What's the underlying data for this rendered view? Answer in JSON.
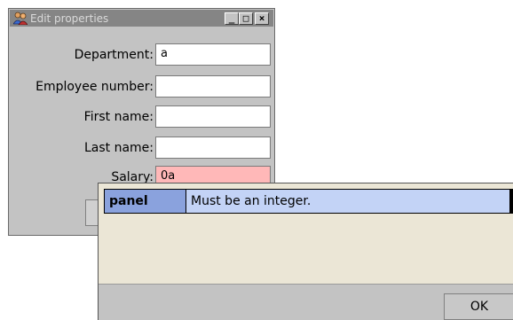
{
  "window": {
    "title": "Edit properties",
    "icon": "people-icon",
    "controls": {
      "minimize": "_",
      "maximize": "□",
      "close": "×"
    }
  },
  "form": {
    "fields": [
      {
        "label": "Department:",
        "value": "a"
      },
      {
        "label": "Employee number:",
        "value": ""
      },
      {
        "label": "First name:",
        "value": ""
      },
      {
        "label": "Last name:",
        "value": ""
      },
      {
        "label": "Salary:",
        "value": "0a",
        "state": "error"
      }
    ],
    "error_color": "#ffb8b8"
  },
  "message": {
    "tag": "panel",
    "text": "Must be an integer.",
    "ok_label": "OK"
  }
}
